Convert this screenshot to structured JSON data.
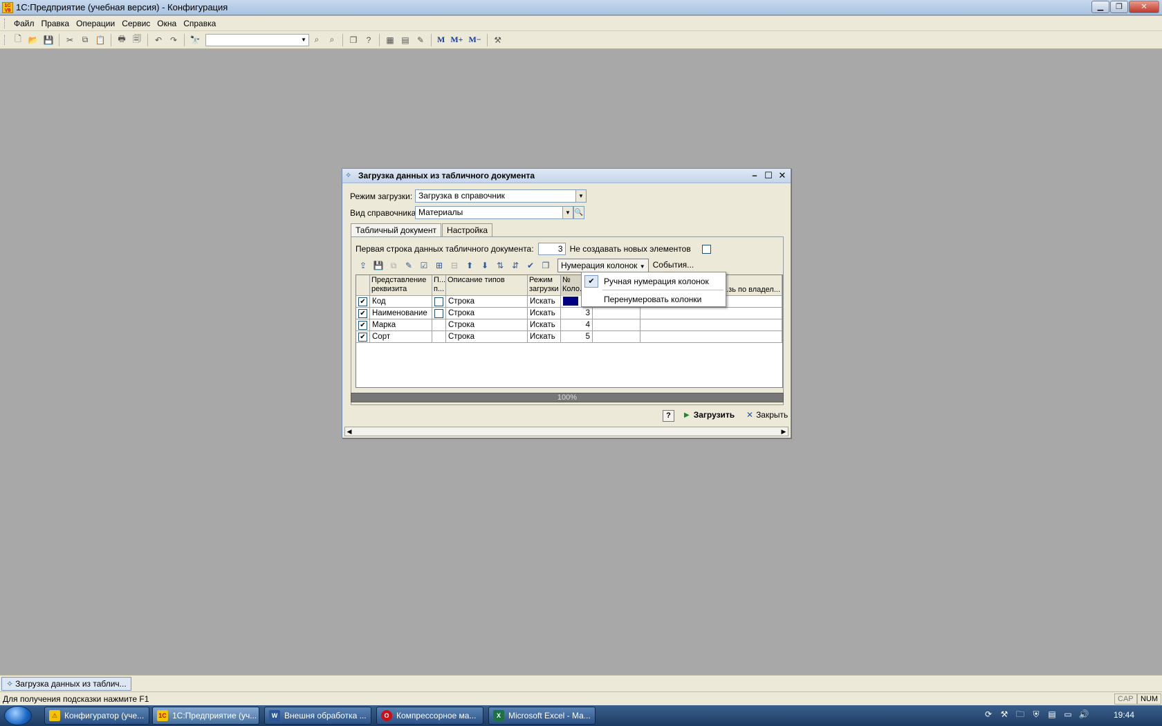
{
  "window": {
    "title": "1С:Предприятие (учебная версия) - Конфигурация",
    "logo": "1С V8"
  },
  "menu": [
    "Файл",
    "Правка",
    "Операции",
    "Сервис",
    "Окна",
    "Справка"
  ],
  "toolbar": {
    "m1": "M",
    "m2": "M+",
    "m3": "M−"
  },
  "dialog": {
    "title": "Загрузка данных из табличного документа",
    "mode_label": "Режим загрузки:",
    "mode_value": "Загрузка в справочник",
    "kind_label": "Вид справочника:",
    "kind_value": "Материалы",
    "tabs": [
      "Табличный документ",
      "Настройка"
    ],
    "first_row_label": "Первая строка данных табличного документа:",
    "first_row_value": "3",
    "no_create_label": "Не создавать новых элементов",
    "numbering_button": "Нумерация колонок",
    "events_button": "События...",
    "columns": [
      "Представление реквизита",
      "П... п...",
      "Описание типов",
      "Режим загрузки",
      "№ Коло...",
      "",
      "...зь по владел..."
    ],
    "rows": [
      {
        "name": "Код",
        "type": "Строка",
        "mode": "Искать",
        "num": ""
      },
      {
        "name": "Наименование",
        "type": "Строка",
        "mode": "Искать",
        "num": "3"
      },
      {
        "name": "Марка",
        "type": "Строка",
        "mode": "Искать",
        "num": "4"
      },
      {
        "name": "Сорт",
        "type": "Строка",
        "mode": "Искать",
        "num": "5"
      }
    ],
    "progress_text": "100%",
    "progress": 1.0,
    "help": "?",
    "load_button": "Загрузить",
    "close_button": "Закрыть"
  },
  "popup": {
    "items": [
      "Ручная нумерация колонок",
      "Перенумеровать колонки"
    ]
  },
  "mdi_tab": "Загрузка данных из таблич...",
  "status": {
    "hint": "Для получения подсказки нажмите F1",
    "cap": "CAP",
    "num": "NUM"
  },
  "taskbar": {
    "buttons": [
      "Конфигуратор (уче...",
      "1С:Предприятие (уч...",
      "Внешня обработка ...",
      "Компрессорное ма...",
      "Microsoft Excel - Ма..."
    ],
    "clock": "19:44"
  }
}
